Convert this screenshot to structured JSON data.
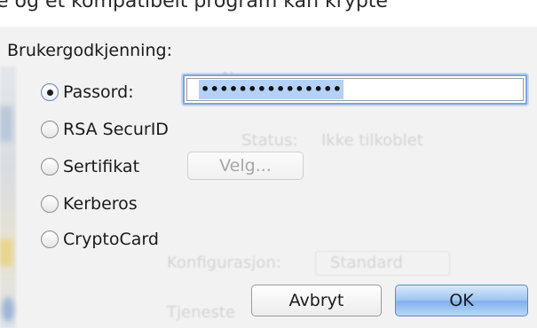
{
  "top_banner_fragment": "e og et kompatibelt program kan krypte",
  "background": {
    "title_fragment": "Navn",
    "status_label": "Status:",
    "status_value": "Ikke tilkoblet",
    "config_label": "Konfigurasjon:",
    "config_value": "Standard",
    "tunnel_fragment": "Tjeneste"
  },
  "auth": {
    "label": "Brukergodkjenning:",
    "options": [
      {
        "label": "Passord:",
        "checked": true
      },
      {
        "label": "RSA SecurID",
        "checked": false
      },
      {
        "label": "Sertifikat",
        "checked": false
      },
      {
        "label": "Kerberos",
        "checked": false
      },
      {
        "label": "CryptoCard",
        "checked": false
      }
    ],
    "password_value": "•••••••••••••••",
    "choose_button": "Velg..."
  },
  "buttons": {
    "cancel": "Avbryt",
    "ok": "OK"
  },
  "colors": {
    "focus_ring": "#7aa5e6",
    "selection": "#b4d2f7",
    "default_button": "#8fbcee"
  }
}
